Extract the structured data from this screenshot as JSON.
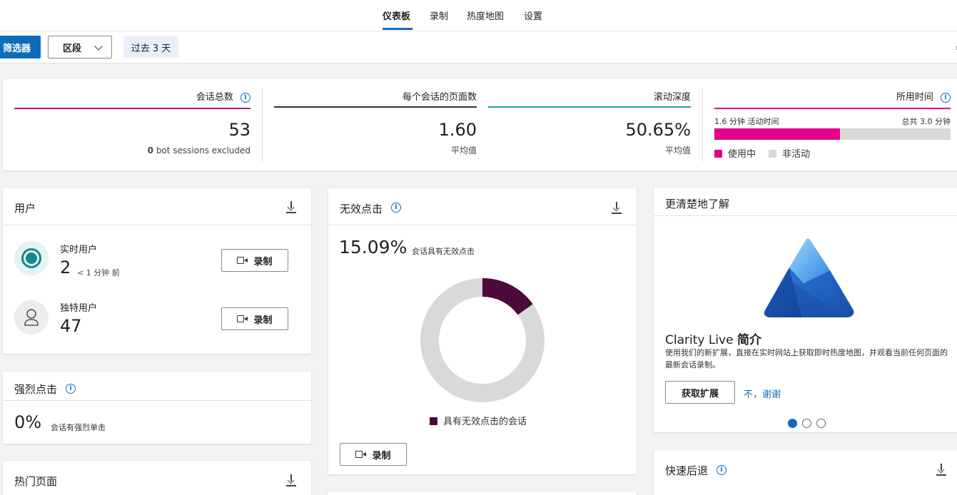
{
  "nav": {
    "tabs": [
      {
        "label": "仪表板",
        "active": true
      },
      {
        "label": "录制"
      },
      {
        "label": "热度地图"
      },
      {
        "label": "设置"
      }
    ]
  },
  "filterbar": {
    "filter_label": "筛选器",
    "segment_label": "区段",
    "date_chip": "过去 3 天",
    "corner_mark": "›"
  },
  "stats": {
    "sessions": {
      "label": "会话总数",
      "value": "53",
      "bot_count": "0",
      "bot_text": "bot sessions excluded"
    },
    "pages_per_session": {
      "label": "每个会话的页面数",
      "value": "1.60",
      "sub": "平均值"
    },
    "scroll_depth": {
      "label": "滚动深度",
      "value": "50.65%",
      "sub": "平均值"
    },
    "time_spent": {
      "label": "所用时间",
      "active_text": "1.6 分钟 活动时间",
      "total_text": "总共 3.0 分钟",
      "active_fraction": 0.533,
      "legend_active": "使用中",
      "legend_inactive": "非活动"
    },
    "colors": {
      "sessions": "#c0127a",
      "pages": "#333333",
      "scroll": "#1a9ba3",
      "time": "#e3008c"
    }
  },
  "users": {
    "title": "用户",
    "live": {
      "label": "实时用户",
      "value": "2",
      "note": "< 1 分钟 前"
    },
    "unique": {
      "label": "独特用户",
      "value": "47"
    },
    "record_label": "录制"
  },
  "rage": {
    "title": "强烈点击",
    "value": "0%",
    "desc": "会话有强烈单击"
  },
  "popular": {
    "title": "热门页面"
  },
  "dead": {
    "title": "无效点击",
    "value": "15.09%",
    "desc": "会话具有无效点击",
    "fraction": 0.1509,
    "legend": "具有无效点击的会话",
    "color": "#4a0a3a",
    "record_label": "录制"
  },
  "promo": {
    "title": "更清楚地了解",
    "headline_a": "Clarity Live ",
    "headline_b": "简介",
    "body": "使用我们的新扩展，直接在实时网站上获取即时热度地图，并观看当前任何页面的最新会话录制。",
    "get_label": "获取扩展",
    "no_label": "不，谢谢",
    "page_index": 1,
    "page_count": 3
  },
  "quickback": {
    "title": "快速后退"
  }
}
